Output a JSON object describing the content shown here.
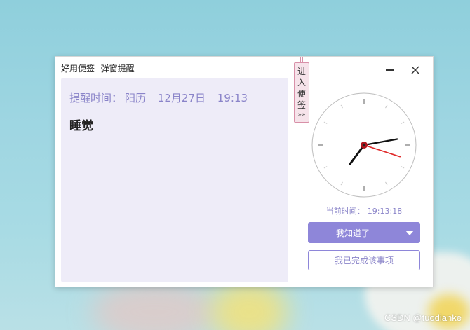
{
  "window": {
    "title": "好用便签--弹窗提醒"
  },
  "note": {
    "remind_label": "提醒时间：",
    "calendar_type": "阳历",
    "date": "12月27日",
    "time": "19:13",
    "content": "睡觉"
  },
  "enter_tab": {
    "chars": [
      "进",
      "入",
      "便",
      "签"
    ],
    "arrow": "»»"
  },
  "clock": {
    "hour": 19,
    "minute": 13,
    "second": 18,
    "hand_colors": {
      "hour": "#111111",
      "minute": "#111111",
      "second": "#e02a2a"
    }
  },
  "current_time": {
    "label": "当前时间：",
    "value": "19:13:18"
  },
  "buttons": {
    "acknowledge": "我知道了",
    "done": "我已完成该事项"
  },
  "colors": {
    "accent": "#8e86d9",
    "note_bg": "#eeecf8",
    "tab_bg": "#f6e3ea"
  },
  "watermark": "CSDN @tuodianke"
}
